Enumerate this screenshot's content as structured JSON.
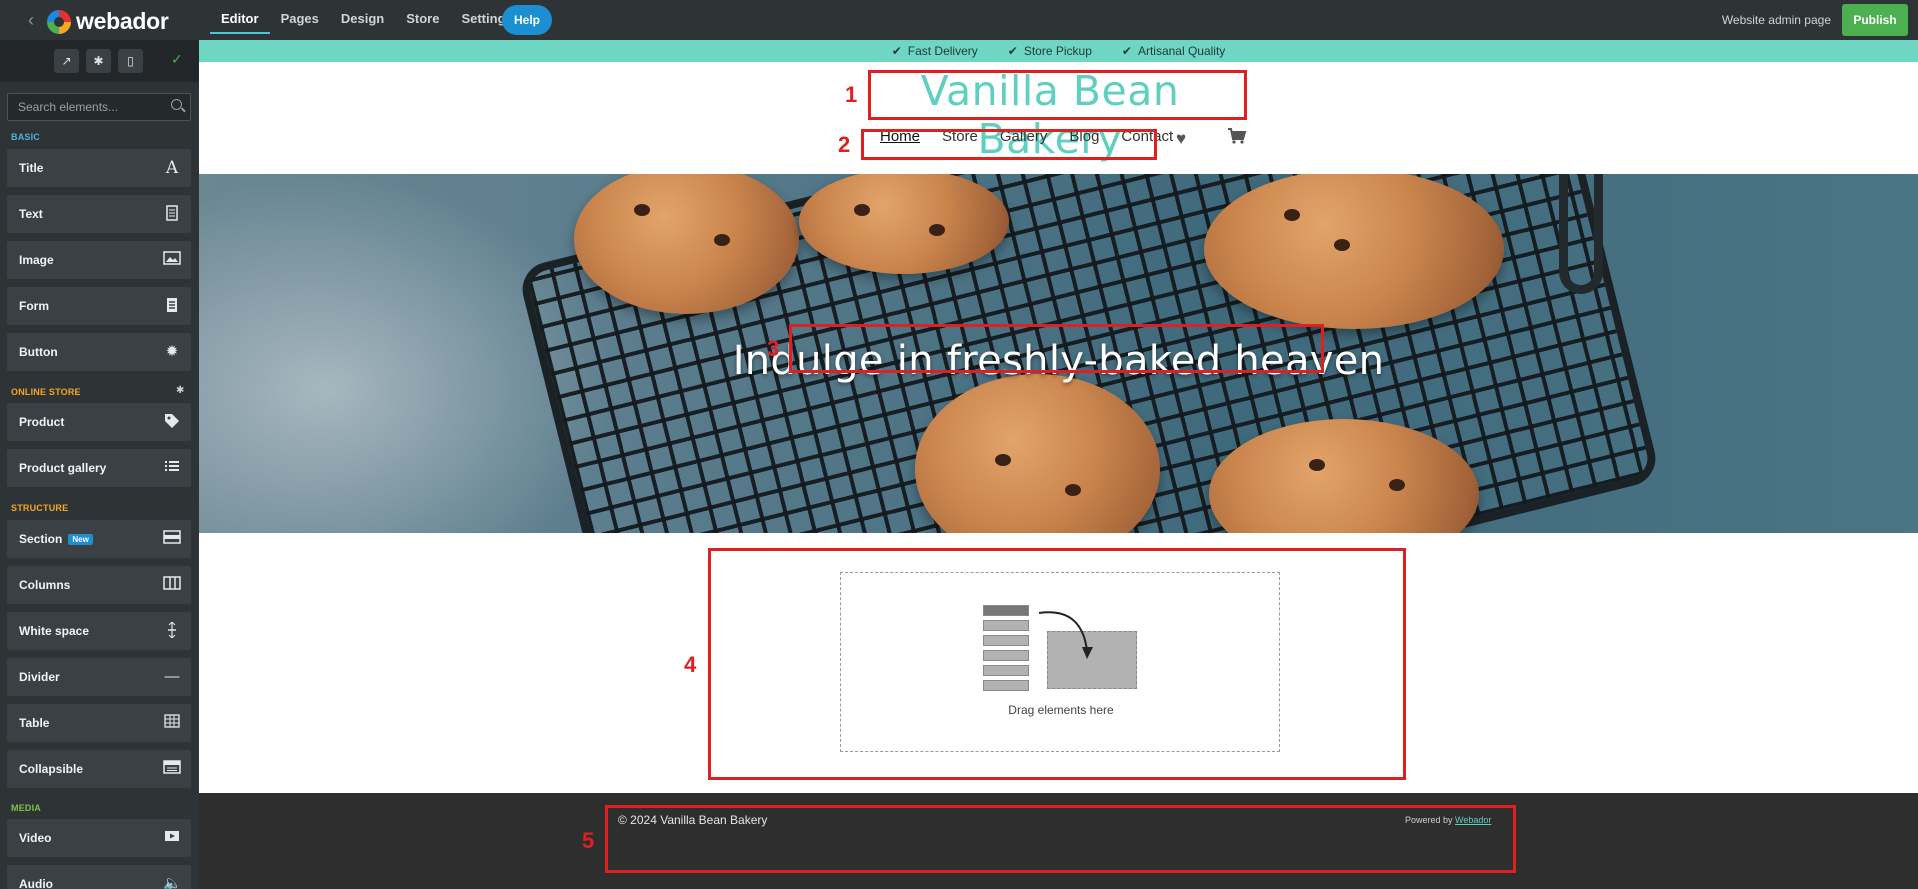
{
  "app": {
    "brand": "webador",
    "nav": [
      "Editor",
      "Pages",
      "Design",
      "Store",
      "Settings"
    ],
    "help_label": "Help",
    "admin_label": "Website admin page",
    "publish_label": "Publish"
  },
  "sidebar": {
    "search_placeholder": "Search elements...",
    "sections": {
      "basic": "BASIC",
      "store": "ONLINE STORE",
      "structure": "STRUCTURE",
      "media": "MEDIA"
    },
    "items": [
      {
        "label": "Title",
        "icon": "title-icon"
      },
      {
        "label": "Text",
        "icon": "text-document-icon"
      },
      {
        "label": "Image",
        "icon": "image-icon"
      },
      {
        "label": "Form",
        "icon": "form-icon"
      },
      {
        "label": "Button",
        "icon": "button-icon"
      },
      {
        "label": "Product",
        "icon": "tag-icon"
      },
      {
        "label": "Product gallery",
        "icon": "list-icon"
      },
      {
        "label": "Section",
        "icon": "section-icon",
        "badge": "New"
      },
      {
        "label": "Columns",
        "icon": "columns-icon"
      },
      {
        "label": "White space",
        "icon": "whitespace-icon"
      },
      {
        "label": "Divider",
        "icon": "divider-icon"
      },
      {
        "label": "Table",
        "icon": "table-icon"
      },
      {
        "label": "Collapsible",
        "icon": "collapsible-icon"
      },
      {
        "label": "Video",
        "icon": "video-icon"
      },
      {
        "label": "Audio",
        "icon": "audio-icon"
      }
    ]
  },
  "site": {
    "usps": [
      "Fast Delivery",
      "Store Pickup",
      "Artisanal Quality"
    ],
    "title": "Vanilla Bean Bakery",
    "nav": [
      "Home",
      "Store",
      "Gallery",
      "Blog",
      "Contact"
    ],
    "hero_heading": "Indulge in freshly-baked heaven",
    "dropzone_label": "Drag elements here",
    "footer_copyright": "© 2024 Vanilla Bean Bakery",
    "footer_powered_prefix": "Powered by",
    "footer_powered_link": "Webador"
  },
  "annotations": [
    "1",
    "2",
    "3",
    "4",
    "5"
  ],
  "colors": {
    "accent_teal": "#5fd0c0",
    "publish_green": "#4caf50",
    "help_blue": "#1b8fd2",
    "annotation_red": "#e02020"
  }
}
